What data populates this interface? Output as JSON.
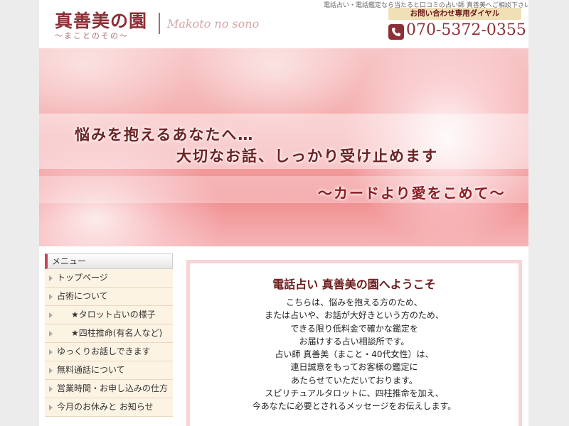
{
  "header": {
    "logo_jp": "真善美の園",
    "logo_sub": "～まことのその～",
    "logo_en": "Makoto no sono",
    "tagline": "電話占い・電話鑑定なら当たると口コミの占い師 真善美へご相談下さい",
    "contact_label": "お問い合わせ専用ダイヤル",
    "phone_number": "070-5372-0355",
    "phone_icon": "phone-icon"
  },
  "banner": {
    "line1": "悩みを抱えるあなたへ…",
    "line2": "大切なお話、しっかり受け止めます",
    "line3": "～カードより愛をこめて～"
  },
  "sidebar": {
    "title": "メニュー",
    "items": [
      {
        "label": "トップページ"
      },
      {
        "label": "占術について"
      },
      {
        "label": "★タロット占いの様子"
      },
      {
        "label": "★四柱推命(有名人など)"
      },
      {
        "label": "ゆっくりお話しできます"
      },
      {
        "label": "無料通話について"
      },
      {
        "label": "営業時間・お申し込みの仕方"
      },
      {
        "label": "今月のお休みと お知らせ"
      }
    ]
  },
  "main": {
    "title": "電話占い 真善美の園へようこそ",
    "lines": [
      "こちらは、悩みを抱える方のため、",
      "または占いや、お話が大好きという方のため、",
      "できる限り低料金で確かな鑑定を",
      "お届けする占い相談所です。",
      "占い師 真善美（まこと・40代女性）は、",
      "連日誠意をもってお客様の鑑定に",
      "あたらせていただいております。",
      "スピリチュアルタロットに、四柱推命を加え、",
      "今あなたに必要とされるメッセージをお伝えします。"
    ]
  },
  "colors": {
    "brand": "#8e2f36",
    "accent_pink": "#f6d4d8",
    "menu_bg": "#fdf3e3"
  }
}
